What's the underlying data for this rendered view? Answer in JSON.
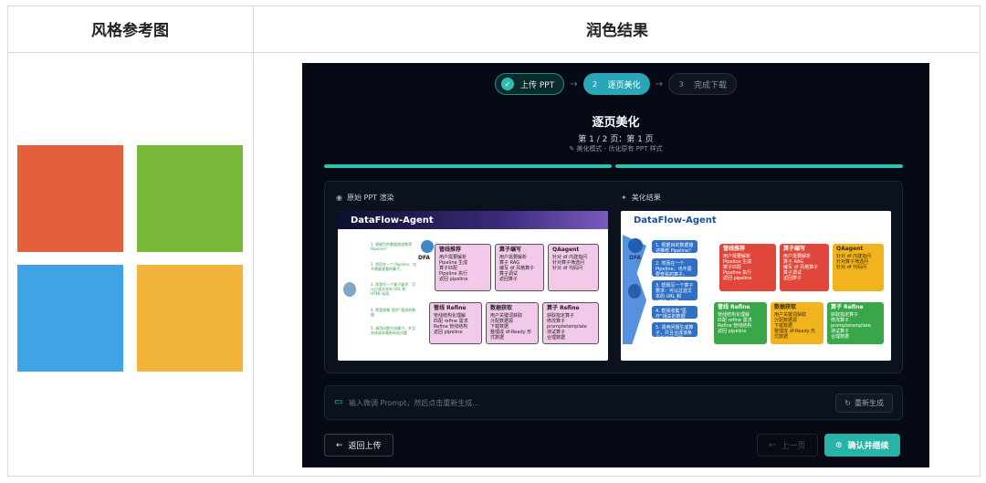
{
  "headers": {
    "left": "风格参考图",
    "right": "润色结果"
  },
  "reference_colors": [
    "#e2613a",
    "#79b93a",
    "#3fa3e6",
    "#f2b43a"
  ],
  "app": {
    "steps": [
      {
        "num": "✓",
        "label": "上传 PPT",
        "state": "done"
      },
      {
        "num": "2",
        "label": "逐页美化",
        "state": "active"
      },
      {
        "num": "3",
        "label": "完成下载",
        "state": "todo"
      }
    ],
    "title": "逐页美化",
    "page_info": "第 1 / 2 页：第 1 页",
    "mode": "美化模式 - 优化原有 PPT 样式",
    "progress": {
      "completed_segments": 2,
      "total_segments": 2
    },
    "panels": {
      "original_label": "原始 PPT 渲染",
      "beautified_label": "美化结果",
      "slide_title": "DataFlow-Agent",
      "dfa": "DFA",
      "steps_text": [
        "1. 根据目的数据描述推荐 Pipeline？",
        "2. 然而在一个 Pipeline，也不需要查看的算子。",
        "3. 帮我写一个算子要求：可以过滤文本的 URL 和 HTML 标签",
        "4. 帮我收集“医疗”相关的数据",
        "5. 调用问题生成算子，并且合成该条最新的关问题"
      ],
      "modules": [
        {
          "name": "管线推荐",
          "items": [
            "用户需要解析",
            "Pipeline 生成",
            "算子匹配",
            "Pipeline 执行",
            "返回 pipeline"
          ]
        },
        {
          "name": "算子编写",
          "items": [
            "用户需要解析",
            "算子 RAG",
            "编写 df 风格算子",
            "算子调试",
            "返回算子"
          ]
        },
        {
          "name": "QAagent",
          "items": [
            "针对 df 内建指问",
            "针对算子筛选问",
            "针对 df 代码问"
          ]
        },
        {
          "name": "管线 Refine",
          "items": [
            "管线结构化理解",
            "匹配 refine 需求",
            "Refine 管线结构",
            "返回 pipeline"
          ]
        },
        {
          "name": "数据获取",
          "items": [
            "用户关键词获取",
            "分配数据源",
            "下载数据",
            "整理成 df-Ready 形式数据"
          ]
        },
        {
          "name": "算子 Refine",
          "items": [
            "获取指定算子",
            "修改算子",
            "promptetemplate",
            "测试算子",
            "合理数据"
          ]
        }
      ]
    },
    "prompt": {
      "placeholder": "输入微调 Prompt，然后点击重新生成...",
      "regenerate": "重新生成"
    },
    "buttons": {
      "back": "返回上传",
      "prev": "上一页",
      "confirm": "确认并继续"
    }
  }
}
